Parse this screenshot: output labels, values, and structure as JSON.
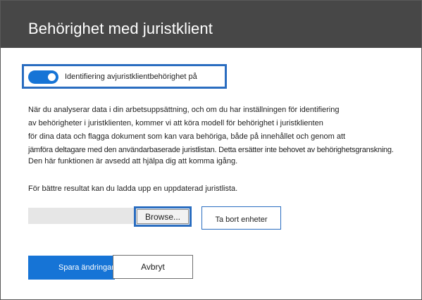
{
  "dialog": {
    "title": "Behörighet med juristklient"
  },
  "toggle": {
    "label": "Identifiering avjuristklientbehörighet på",
    "state": "on",
    "accent": "#1674d6"
  },
  "description": {
    "lines": [
      "När du analyserar data i din arbetsuppsättning, och om du har inställningen för identifiering",
      "av behörigheter i juristklienten, kommer vi att köra modell för behörighet i juristklienten",
      "för dina data och flagga dokument som kan vara behöriga, både på innehållet och genom att",
      "jämföra deltagare med den användarbaserade juristlistan. Detta ersätter inte behovet av behörighetsgranskning."
    ],
    "note": "Den här funktionen är avsedd att hjälpa dig att komma igång."
  },
  "upload": {
    "text": "För bättre resultat kan du ladda upp en uppdaterad juristlista.",
    "file_value": "",
    "browse_label": "Browse...",
    "remove_label": "Ta bort enheter"
  },
  "footer": {
    "save_label": "Spara ändringar",
    "cancel_label": "Avbryt"
  },
  "colors": {
    "header_bg": "#474747",
    "primary": "#1674d6",
    "focus_border": "#2a6dc0"
  }
}
